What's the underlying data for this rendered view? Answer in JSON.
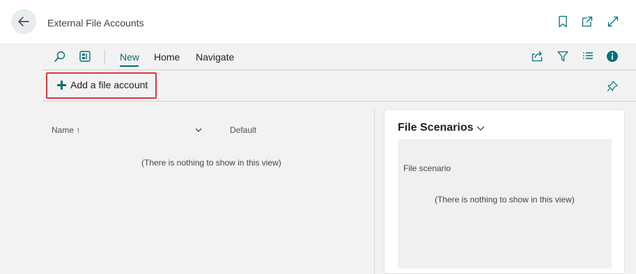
{
  "title_bar": {
    "title": "External File Accounts",
    "icons": [
      "back-arrow-icon",
      "bookmark-icon",
      "open-new-window-icon",
      "expand-icon"
    ]
  },
  "command_bar": {
    "icons": [
      "search-icon",
      "layout-icon"
    ],
    "tabs": [
      {
        "label": "New",
        "active": true
      },
      {
        "label": "Home",
        "active": false
      },
      {
        "label": "Navigate",
        "active": false
      }
    ],
    "right_icons": [
      "share-icon",
      "filter-icon",
      "list-view-icon",
      "info-icon"
    ]
  },
  "actions": {
    "add_file_account": "Add a file account",
    "pin_icon": "pin-icon"
  },
  "list": {
    "columns": [
      "Name",
      "Default"
    ],
    "sort_indicator": "↑",
    "empty_message": "(There is nothing to show in this view)"
  },
  "factbox": {
    "title": "File Scenarios",
    "column": "File scenario",
    "empty_message": "(There is nothing to show in this view)"
  },
  "colors": {
    "accent": "#00707a",
    "highlight_border": "#d9373a",
    "background": "#f2f2f2"
  }
}
